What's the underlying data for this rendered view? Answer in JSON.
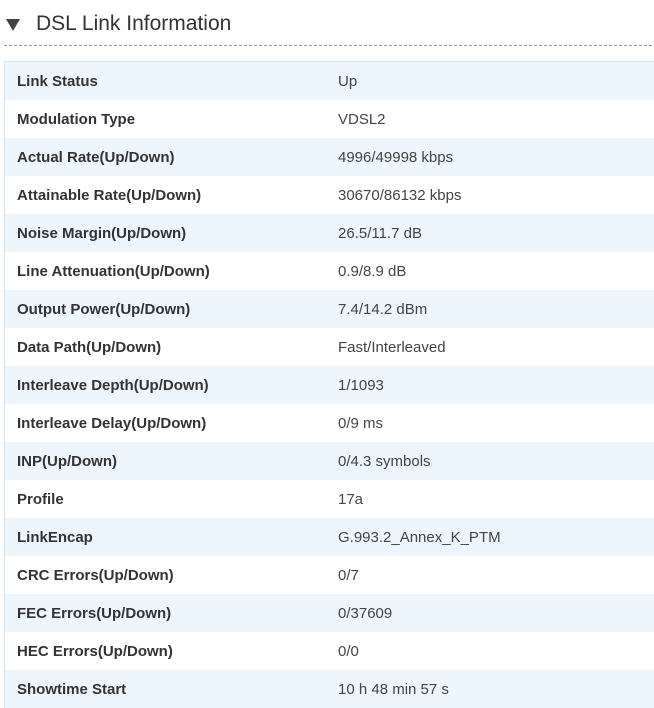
{
  "section": {
    "title": "DSL Link Information",
    "icon": "triangle-down-icon"
  },
  "rows": [
    {
      "label": "Link Status",
      "value": "Up"
    },
    {
      "label": "Modulation Type",
      "value": "VDSL2"
    },
    {
      "label": "Actual Rate(Up/Down)",
      "value": "4996/49998 kbps"
    },
    {
      "label": "Attainable Rate(Up/Down)",
      "value": "30670/86132 kbps"
    },
    {
      "label": "Noise Margin(Up/Down)",
      "value": "26.5/11.7 dB"
    },
    {
      "label": "Line Attenuation(Up/Down)",
      "value": "0.9/8.9 dB"
    },
    {
      "label": "Output Power(Up/Down)",
      "value": "7.4/14.2 dBm"
    },
    {
      "label": "Data Path(Up/Down)",
      "value": "Fast/Interleaved"
    },
    {
      "label": "Interleave Depth(Up/Down)",
      "value": "1/1093"
    },
    {
      "label": "Interleave Delay(Up/Down)",
      "value": "0/9 ms"
    },
    {
      "label": "INP(Up/Down)",
      "value": "0/4.3 symbols"
    },
    {
      "label": "Profile",
      "value": "17a"
    },
    {
      "label": "LinkEncap",
      "value": "G.993.2_Annex_K_PTM"
    },
    {
      "label": "CRC Errors(Up/Down)",
      "value": "0/7"
    },
    {
      "label": "FEC Errors(Up/Down)",
      "value": "0/37609"
    },
    {
      "label": "HEC Errors(Up/Down)",
      "value": "0/0"
    },
    {
      "label": "Showtime Start",
      "value": "10 h 48 min 57 s"
    }
  ],
  "colors": {
    "row_alt": "#edf5fd",
    "row_base": "#ffffff",
    "border": "#d6e2ef",
    "text": "#333333"
  }
}
